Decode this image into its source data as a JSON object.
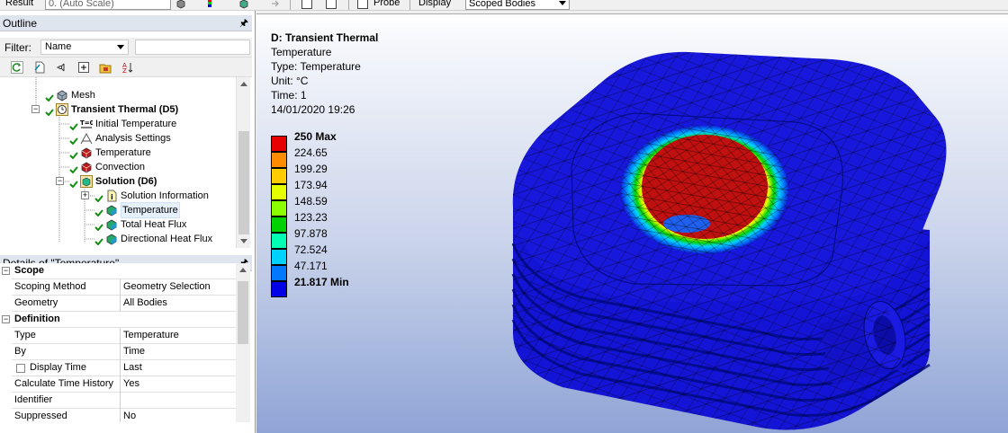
{
  "toolbar": {
    "result_label": "Result",
    "scale_value": "0. (Auto Scale)",
    "probe_label": "Probe",
    "display_label": "Display",
    "display_value": "Scoped Bodies"
  },
  "outline": {
    "title": "Outline",
    "filter_label": "Filter:",
    "filter_value": "Name",
    "filter_text": "",
    "tree": [
      {
        "label": "Mesh"
      },
      {
        "label": "Transient Thermal (D5)"
      },
      {
        "label": "Initial Temperature"
      },
      {
        "label": "Analysis Settings"
      },
      {
        "label": "Temperature"
      },
      {
        "label": "Convection"
      },
      {
        "label": "Solution (D6)"
      },
      {
        "label": "Solution Information"
      },
      {
        "label": "Temperature"
      },
      {
        "label": "Total Heat Flux"
      },
      {
        "label": "Directional Heat Flux"
      }
    ]
  },
  "details": {
    "title": "Details of \"Temperature\"",
    "rows": [
      {
        "key": "Scope",
        "value": ""
      },
      {
        "key": "Scoping Method",
        "value": "Geometry Selection"
      },
      {
        "key": "Geometry",
        "value": "All Bodies"
      },
      {
        "key": "Definition",
        "value": ""
      },
      {
        "key": "Type",
        "value": "Temperature"
      },
      {
        "key": "By",
        "value": "Time"
      },
      {
        "key": "Display Time",
        "value": "Last"
      },
      {
        "key": "Calculate Time History",
        "value": "Yes"
      },
      {
        "key": "Identifier",
        "value": ""
      },
      {
        "key": "Suppressed",
        "value": "No"
      }
    ]
  },
  "viewport": {
    "info": {
      "title": "D: Transient Thermal",
      "result": "Temperature",
      "type": "Type: Temperature",
      "unit": "Unit: °C",
      "time": "Time: 1",
      "timestamp": "14/01/2020 19:26"
    },
    "legend": [
      {
        "label": "250 Max",
        "color": "#e60000"
      },
      {
        "label": "224.65",
        "color": "#ff8c00"
      },
      {
        "label": "199.29",
        "color": "#ffcc00"
      },
      {
        "label": "173.94",
        "color": "#e6ff00"
      },
      {
        "label": "148.59",
        "color": "#8cff00"
      },
      {
        "label": "123.23",
        "color": "#00d200"
      },
      {
        "label": "97.878",
        "color": "#00ffb4"
      },
      {
        "label": "72.524",
        "color": "#00d2ff"
      },
      {
        "label": "47.171",
        "color": "#0078ff"
      },
      {
        "label": "21.817 Min",
        "color": "#0000e6"
      }
    ]
  }
}
